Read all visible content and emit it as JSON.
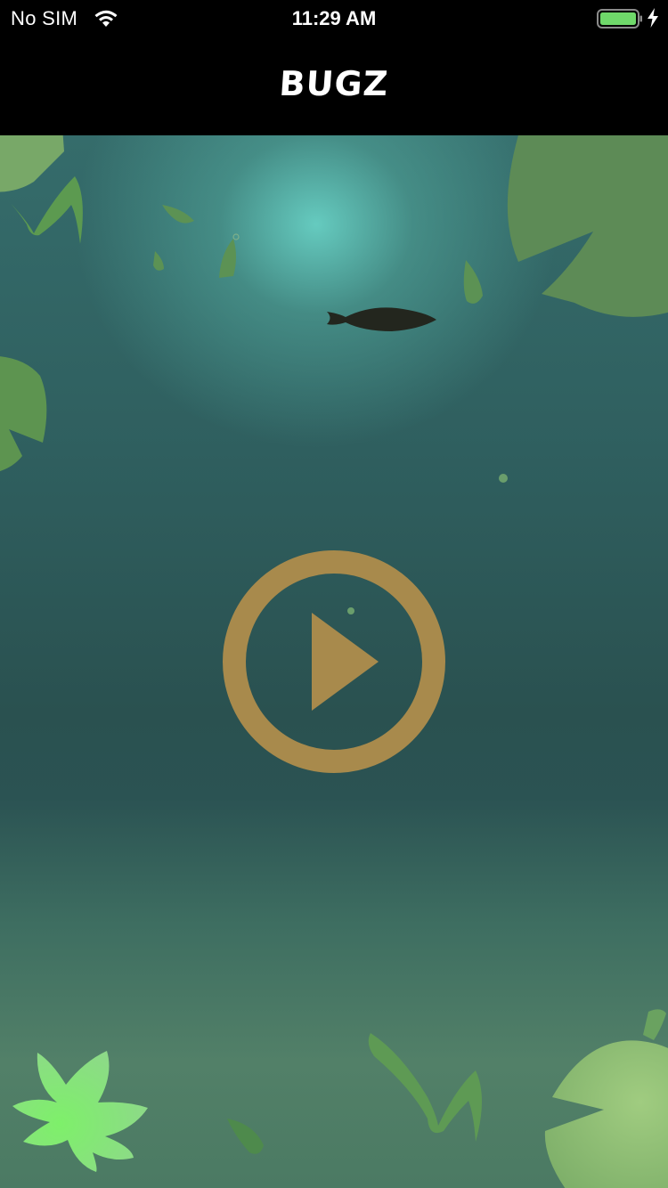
{
  "status_bar": {
    "carrier": "No SIM",
    "time": "11:29 AM",
    "battery_color": "#6fd86a",
    "charging": true
  },
  "nav": {
    "title": "BUGZ"
  },
  "scene": {
    "play_button_color": "#a88a4c",
    "leaf_color": "#5a8a4e",
    "fish_color": "#23261e",
    "flower_color": "#7ee06a"
  }
}
